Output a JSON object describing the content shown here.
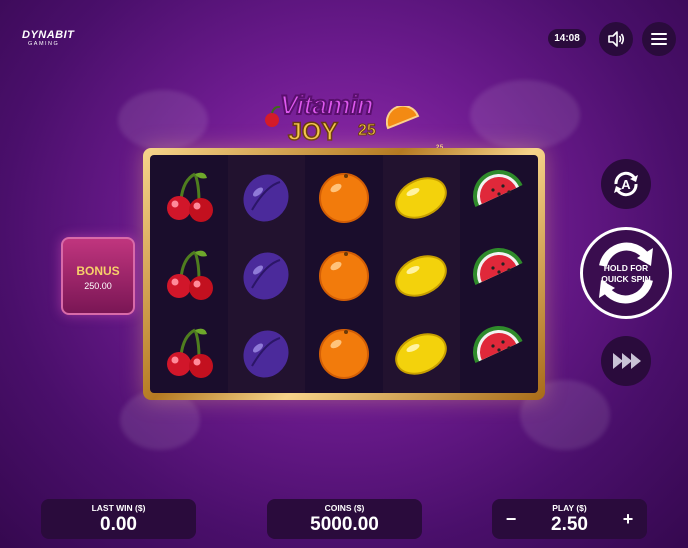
{
  "brand": {
    "name": "DYNABIT",
    "sub": "GAMING"
  },
  "header": {
    "clock": "14:08",
    "icons": [
      "speaker-icon",
      "menu-icon"
    ]
  },
  "logo": {
    "line1": "Vitamin",
    "line2": "JOY",
    "number": "25",
    "lines_label": "25 LINES"
  },
  "bonus": {
    "label": "BONUS",
    "value": "250.00"
  },
  "reels": {
    "columns": [
      [
        "cherry",
        "cherry",
        "cherry"
      ],
      [
        "plum",
        "plum",
        "plum"
      ],
      [
        "orange",
        "orange",
        "orange"
      ],
      [
        "lemon",
        "lemon",
        "lemon"
      ],
      [
        "watermelon",
        "watermelon",
        "watermelon"
      ]
    ]
  },
  "controls": {
    "spin_label_1": "HOLD FOR",
    "spin_label_2": "QUICK SPIN",
    "icons": [
      "autoplay-icon",
      "spin-icon",
      "turbo-icon"
    ]
  },
  "footer": {
    "last_win_label": "LAST WIN ($)",
    "last_win_value": "0.00",
    "coins_label": "COINS ($)",
    "coins_value": "5000.00",
    "play_label": "PLAY ($)",
    "play_value": "2.50",
    "minus": "−",
    "plus": "+"
  },
  "colors": {
    "gold": "#f4c84a",
    "panel": "#2a0b3c",
    "bg": "#6d1b8f"
  }
}
